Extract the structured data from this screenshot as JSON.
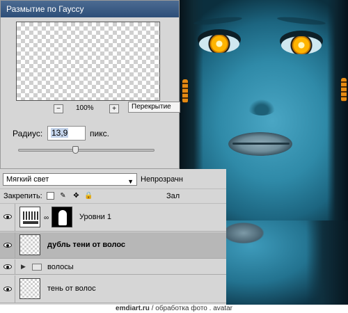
{
  "dialog": {
    "title": "Размытие по Гауссу",
    "zoom_minus": "−",
    "zoom_value": "100%",
    "zoom_plus": "+",
    "tooltip": "Перекрытие",
    "radius_label": "Радиус:",
    "radius_value": "13,9",
    "radius_unit": "пикс.",
    "radius_slider_fraction": 0.42
  },
  "layers_panel": {
    "blend_mode": "Мягкий свет",
    "opacity_label": "Непрозрачн",
    "lock_label": "Закрепить:",
    "fill_label": "Зал",
    "layers": [
      {
        "name": "Уровни 1",
        "kind": "adjustment",
        "visible": true,
        "selected": false
      },
      {
        "name": "дубль тени от волос",
        "kind": "pixel",
        "visible": true,
        "selected": true
      },
      {
        "name": "волосы",
        "kind": "group",
        "visible": true,
        "selected": false
      },
      {
        "name": "тень от волос",
        "kind": "pixel",
        "visible": true,
        "selected": false
      }
    ]
  },
  "icons": {
    "lock_transparency": "checker-icon",
    "lock_paint": "brush-icon",
    "lock_move": "move-icon",
    "lock_all": "lock-icon",
    "visibility": "eye-icon",
    "group": "folder-icon"
  },
  "footer": {
    "site": "emdiart.ru",
    "caption": "/ обработка фото . avatar"
  }
}
